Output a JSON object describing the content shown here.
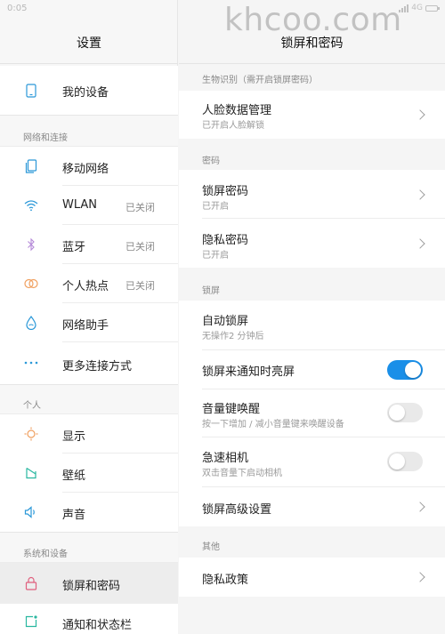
{
  "status_bar": {
    "time": "0:05",
    "network": "4G"
  },
  "watermark": "khcoo.com",
  "left_panel": {
    "title": "设置",
    "items": [
      {
        "label": "我的设备",
        "icon": "phone-icon"
      },
      {
        "label": "移动网络",
        "icon": "sim-card-icon"
      },
      {
        "label": "WLAN",
        "value": "已关闭",
        "icon": "wifi-icon"
      },
      {
        "label": "蓝牙",
        "value": "已关闭",
        "icon": "bluetooth-icon"
      },
      {
        "label": "个人热点",
        "value": "已关闭",
        "icon": "hotspot-icon"
      },
      {
        "label": "网络助手",
        "icon": "water-drop-icon"
      },
      {
        "label": "更多连接方式",
        "icon": "more-dots-icon"
      },
      {
        "label": "显示",
        "icon": "sun-icon"
      },
      {
        "label": "壁纸",
        "icon": "wallpaper-icon"
      },
      {
        "label": "声音",
        "icon": "speaker-icon"
      },
      {
        "label": "锁屏和密码",
        "icon": "lock-icon"
      },
      {
        "label": "通知和状态栏",
        "icon": "notification-icon"
      }
    ],
    "sections": [
      "网络和连接",
      "个人",
      "系统和设备"
    ]
  },
  "right_panel": {
    "title": "锁屏和密码",
    "sections": [
      "生物识别（需开启锁屏密码）",
      "密码",
      "锁屏",
      "其他"
    ],
    "items": [
      {
        "title": "人脸数据管理",
        "sub": "已开启人脸解锁"
      },
      {
        "title": "锁屏密码",
        "sub": "已开启"
      },
      {
        "title": "隐私密码",
        "sub": "已开启"
      },
      {
        "title": "自动锁屏",
        "sub": "无操作2 分钟后"
      },
      {
        "title": "锁屏来通知时亮屏",
        "toggle": true
      },
      {
        "title": "音量键唤醒",
        "sub": "按一下增加 / 减小音量键来唤醒设备",
        "toggle": false
      },
      {
        "title": "急速相机",
        "sub": "双击音量下启动相机",
        "toggle": false
      },
      {
        "title": "锁屏高级设置"
      },
      {
        "title": "隐私政策"
      }
    ]
  },
  "colors": {
    "accent": "#1a8fe8",
    "icon": "#2b98d8",
    "lock_icon": "#e0607e"
  }
}
